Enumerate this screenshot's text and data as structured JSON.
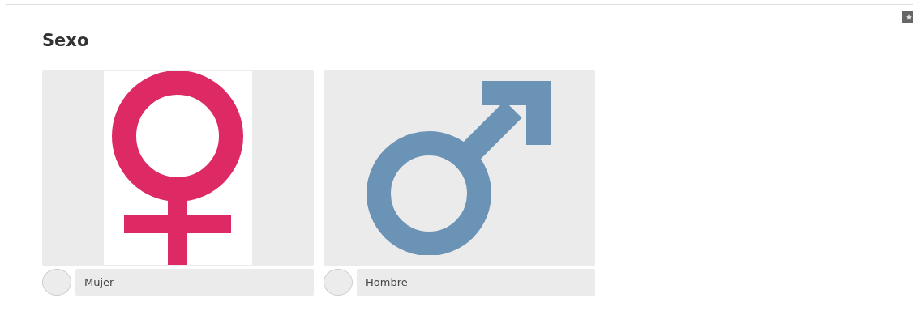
{
  "question": {
    "title": "Sexo"
  },
  "options": [
    {
      "label": "Mujer",
      "kind": "female",
      "selected": false
    },
    {
      "label": "Hombre",
      "kind": "male",
      "selected": false
    }
  ]
}
